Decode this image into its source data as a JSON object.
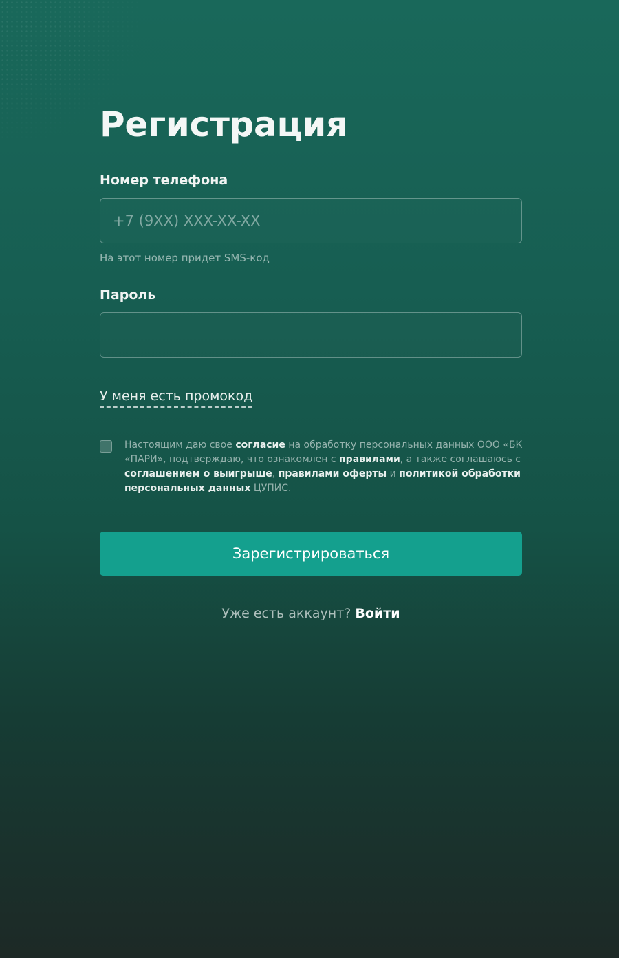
{
  "page": {
    "title": "Регистрация"
  },
  "phone": {
    "label": "Номер телефона",
    "placeholder": "+7 (9XX) XXX-XX-XX",
    "hint": "На этот номер придет SMS-код"
  },
  "password": {
    "label": "Пароль",
    "value": ""
  },
  "promo": {
    "label": "У меня есть промокод"
  },
  "consent": {
    "checked": false,
    "t1": "Настоящим даю свое ",
    "l1": "согласие",
    "t2": " на обработку персональных данных ООО «БК «ПАРИ», подтверждаю, что ознакомлен с ",
    "l2": "правилами",
    "t3": ", а также соглашаюсь с ",
    "l3": "соглашением о выигрыше",
    "t4": ", ",
    "l4": "правилами оферты",
    "t5": " и ",
    "l5": "политикой обработки персональных данных",
    "t6": " ЦУПИС."
  },
  "submit": {
    "label": "Зарегистрироваться"
  },
  "login": {
    "prompt": "Уже есть аккаунт?",
    "link": "Войти"
  },
  "colors": {
    "background_top": "#19685a",
    "background_bottom": "#1d2926",
    "accent": "#14a08e"
  }
}
